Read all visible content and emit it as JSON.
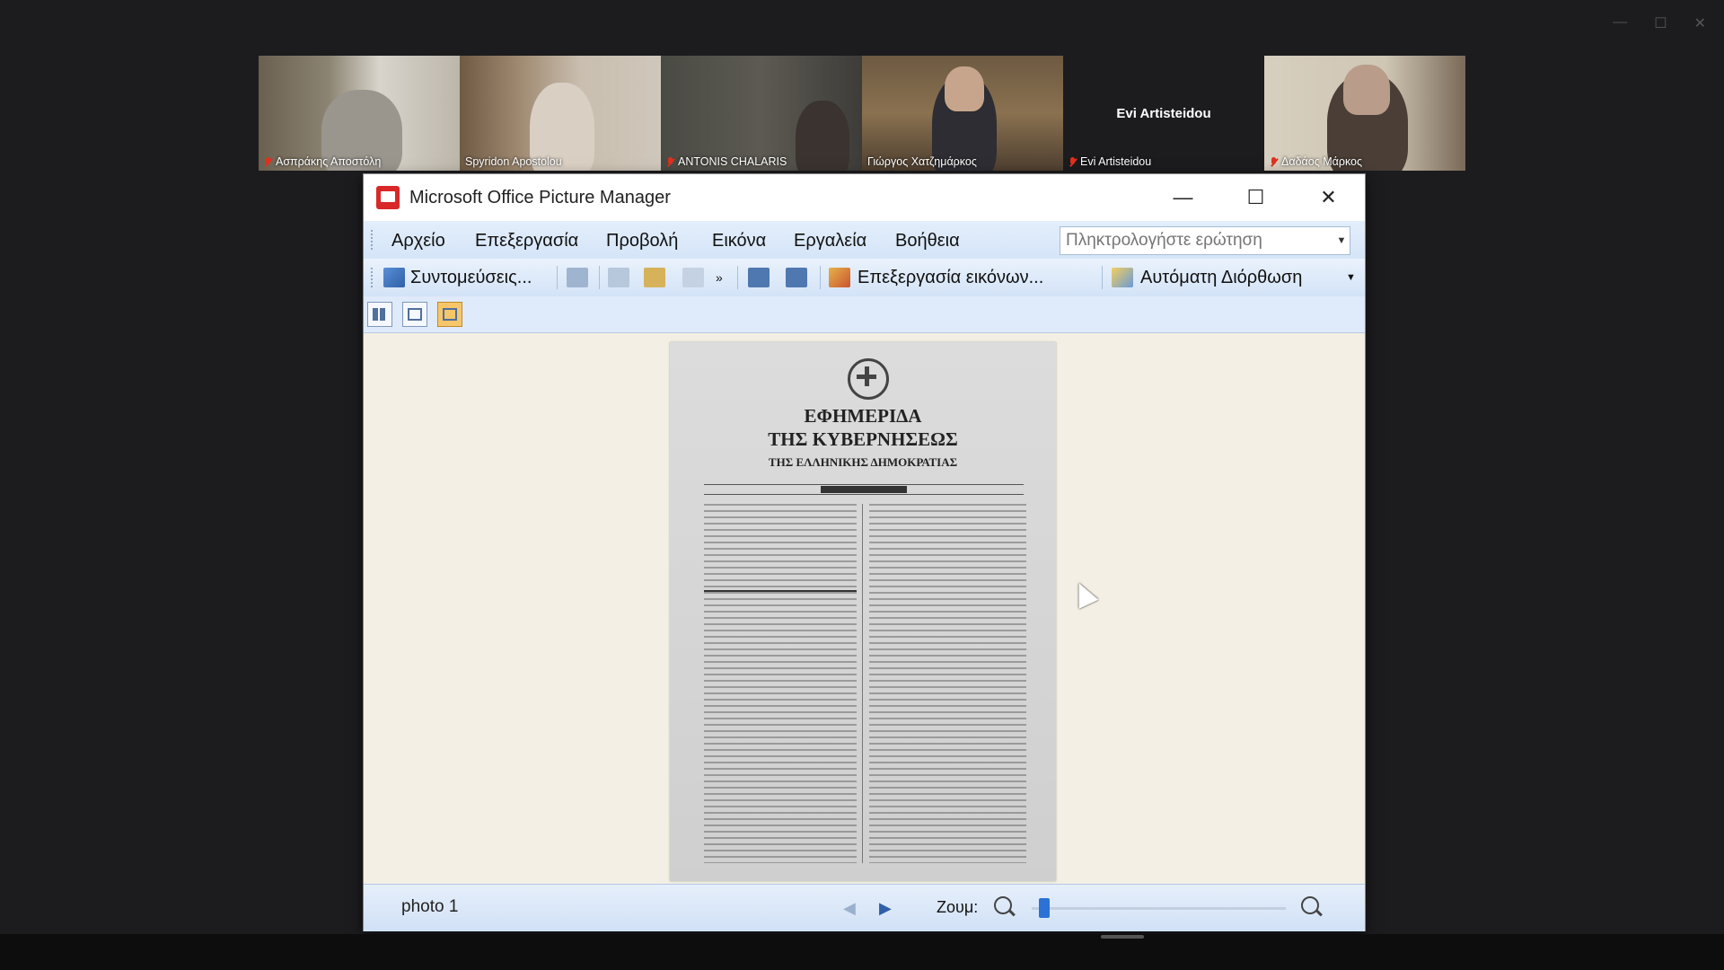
{
  "participants": [
    {
      "name": "Ασπράκης Αποστόλη",
      "muted": true,
      "active": false
    },
    {
      "name": "Spyridon Apostolou",
      "muted": false,
      "active": false
    },
    {
      "name": "ANTONIS CHALARIS",
      "muted": true,
      "active": false
    },
    {
      "name": "Γιώργος Χατζημάρκος",
      "muted": false,
      "active": true
    },
    {
      "name": "Evi Artisteidou",
      "muted": true,
      "active": false,
      "video_off": true,
      "center_label": "Evi Artisteidou"
    },
    {
      "name": "Δαδάος Μάρκος",
      "muted": true,
      "active": false
    }
  ],
  "window": {
    "title": "Microsoft Office Picture Manager",
    "controls": {
      "minimize": "—",
      "maximize": "☐",
      "close": "✕"
    }
  },
  "menu": {
    "items": [
      "Αρχείο",
      "Επεξεργασία",
      "Προβολή",
      "Εικόνα",
      "Εργαλεία",
      "Βοήθεια"
    ],
    "ask_placeholder": "Πληκτρολογήστε ερώτηση"
  },
  "toolbar": {
    "shortcuts_label": "Συντομεύσεις...",
    "edit_pictures_label": "Επεξεργασία εικόνων...",
    "autocorrect_label": "Αυτόματη Διόρθωση"
  },
  "document": {
    "title_line1": "ΕΦΗΜΕΡΙΔΑ",
    "title_line2": "ΤΗΣ ΚΥΒΕΡΝΗΣΕΩΣ",
    "subtitle": "ΤΗΣ ΕΛΛΗΝΙΚΗΣ ΔΗΜΟΚΡΑΤΙΑΣ"
  },
  "status": {
    "picture_name": "photo 1",
    "zoom_label": "Ζουμ:",
    "zoom_level": 0.03
  }
}
